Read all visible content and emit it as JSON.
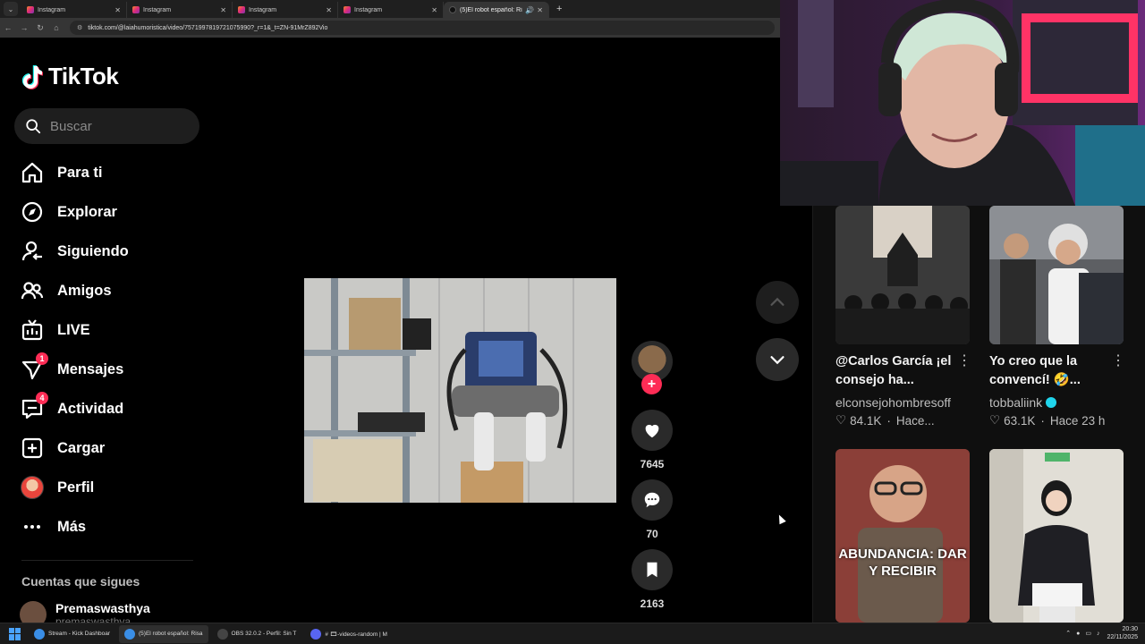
{
  "browser": {
    "tabs": [
      {
        "label": "Instagram",
        "active": false
      },
      {
        "label": "Instagram",
        "active": false
      },
      {
        "label": "Instagram",
        "active": false
      },
      {
        "label": "Instagram",
        "active": false
      },
      {
        "label": "(5)El robot español: Risas y",
        "active": true
      }
    ],
    "url": "tiktok.com/@laiahumoristica/video/7571997819721075990?_r=1&_t=ZN-91MrZ892Vio"
  },
  "sidebar": {
    "logo": "TikTok",
    "search_placeholder": "Buscar",
    "items": [
      {
        "label": "Para ti",
        "icon": "home-icon"
      },
      {
        "label": "Explorar",
        "icon": "compass-icon"
      },
      {
        "label": "Siguiendo",
        "icon": "following-icon"
      },
      {
        "label": "Amigos",
        "icon": "friends-icon"
      },
      {
        "label": "LIVE",
        "icon": "live-icon"
      },
      {
        "label": "Mensajes",
        "icon": "messages-icon",
        "badge": "1"
      },
      {
        "label": "Actividad",
        "icon": "activity-icon",
        "badge": "4"
      },
      {
        "label": "Cargar",
        "icon": "upload-icon"
      },
      {
        "label": "Perfil",
        "icon": "profile-avatar"
      },
      {
        "label": "Más",
        "icon": "more-icon"
      }
    ],
    "following_title": "Cuentas que sigues",
    "following_account": {
      "name": "Premaswasthya",
      "handle": "premaswasthya"
    }
  },
  "actions": {
    "likes": "7645",
    "comments": "70",
    "saves": "2163"
  },
  "recommendations": [
    {
      "title": "@Carlos García ¡el consejo ha...",
      "author": "elconsejohombresoff",
      "likes": "84.1K",
      "time": "Hace..."
    },
    {
      "title": "Yo creo que la convencí! 🤣...",
      "author": "tobbaliink",
      "likes": "63.1K",
      "time": "Hace 23 h",
      "verified": true
    },
    {
      "overlay_text": "ABUNDANCIA: DAR Y RECIBIR"
    },
    {}
  ],
  "taskbar": {
    "apps": [
      {
        "label": "Stream - Kick Dashboar",
        "color": "#3a8ee6"
      },
      {
        "label": "(5)El robot español: Risa",
        "color": "#3a8ee6",
        "active": true
      },
      {
        "label": "OBS 32.0.2 - Perfil: Sin T",
        "color": "#444444"
      },
      {
        "label": "# 🎞-videos-random | M",
        "color": "#5865f2"
      }
    ],
    "time": "20:30",
    "date": "22/11/2025"
  },
  "colors": {
    "accent": "#fe2c55",
    "background": "#000000",
    "surface": "#1e1e1e"
  }
}
